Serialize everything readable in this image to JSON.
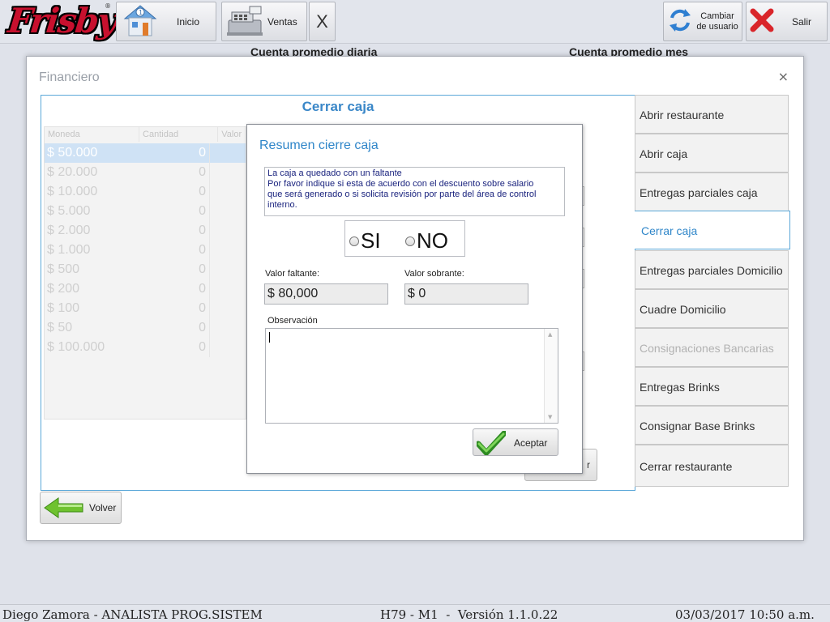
{
  "app": {
    "logo_text": "Frisby",
    "logo_reg": "®"
  },
  "toolbar": {
    "inicio_label": "Inicio",
    "ventas_label": "Ventas",
    "close_label": "X",
    "cambiar_usuario_label": "Cambiar de usuario",
    "salir_label": "Salir"
  },
  "background": {
    "left_label": "Cuenta promedio diaria",
    "right_label": "Cuenta promedio mes"
  },
  "dialog": {
    "title": "Financiero",
    "close": "×",
    "panel_title": "Cerrar caja",
    "grid": {
      "headers": [
        "Moneda",
        "Cantidad",
        "Valor"
      ],
      "rows": [
        {
          "moneda": "$ 50.000",
          "cantidad": "0"
        },
        {
          "moneda": "$ 20.000",
          "cantidad": "0"
        },
        {
          "moneda": "$ 10.000",
          "cantidad": "0"
        },
        {
          "moneda": "$ 5.000",
          "cantidad": "0"
        },
        {
          "moneda": "$ 2.000",
          "cantidad": "0"
        },
        {
          "moneda": "$ 1.000",
          "cantidad": "0"
        },
        {
          "moneda": "$ 500",
          "cantidad": "0"
        },
        {
          "moneda": "$ 200",
          "cantidad": "0"
        },
        {
          "moneda": "$ 100",
          "cantidad": "0"
        },
        {
          "moneda": "$ 50",
          "cantidad": "0"
        },
        {
          "moneda": "$ 100.000",
          "cantidad": "0"
        }
      ]
    },
    "ghost_button_label": "r",
    "menu": [
      {
        "label": "Abrir restaurante",
        "state": "normal"
      },
      {
        "label": "Abrir caja",
        "state": "normal"
      },
      {
        "label": "Entregas parciales caja",
        "state": "normal"
      },
      {
        "label": "Cerrar caja",
        "state": "active"
      },
      {
        "label": "Entregas parciales Domicilio",
        "state": "normal"
      },
      {
        "label": "Cuadre Domicilio",
        "state": "normal"
      },
      {
        "label": "Consignaciones Bancarias",
        "state": "disabled"
      },
      {
        "label": "Entregas Brinks",
        "state": "normal"
      },
      {
        "label": "Consignar Base Brinks",
        "state": "normal"
      },
      {
        "label": "Cerrar restaurante",
        "state": "normal"
      }
    ],
    "volver_label": "Volver"
  },
  "modal": {
    "title": "Resumen cierre caja",
    "message": "La caja a quedado con un faltante\nPor favor indique si esta de acuerdo con el descuento sobre salario\nque será generado o si solicita revisión por parte del área de control\ninterno.",
    "option_si": "SI",
    "option_no": "NO",
    "valor_faltante_label": "Valor faltante:",
    "valor_faltante": "$ 80,000",
    "valor_sobrante_label": "Valor sobrante:",
    "valor_sobrante": "$ 0",
    "observacion_label": "Observación",
    "observacion_value": "",
    "aceptar_label": "Aceptar"
  },
  "statusbar": {
    "user": "Diego Zamora - ANALISTA PROG.SISTEM",
    "version": "H79 - M1  -  Versión 1.1.0.22",
    "datetime": "03/03/2017 10:50 a.m."
  },
  "colors": {
    "accent_blue": "#2f86c9",
    "brand_red": "#c8102e",
    "message_text": "#1a237e"
  }
}
